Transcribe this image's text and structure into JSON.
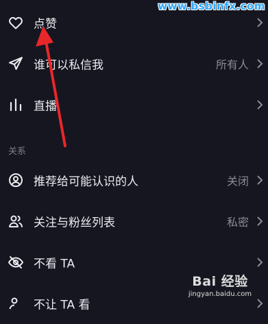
{
  "settings": {
    "items": [
      {
        "label": "点赞",
        "value": ""
      },
      {
        "label": "谁可以私信我",
        "value": "所有人"
      },
      {
        "label": "直播",
        "value": ""
      },
      {
        "label": "推荐给可能认识的人",
        "value": "关闭"
      },
      {
        "label": "关注与粉丝列表",
        "value": "私密"
      },
      {
        "label": "不看 TA",
        "value": ""
      },
      {
        "label": "不让 TA 看",
        "value": ""
      }
    ],
    "section_relations": "关系"
  },
  "watermark": {
    "top": "www.bsbinfx.com",
    "bottom_main": "Bai 经验",
    "bottom_sub": "jingyan.baidu.com"
  },
  "colors": {
    "background": "#15161f",
    "text": "#ececf1",
    "secondary_text": "#8a8b93",
    "annotation_arrow": "#e8272b"
  },
  "icons": [
    "heart-icon",
    "send-icon",
    "live-bars-icon",
    "person-circle-icon",
    "people-icon",
    "eye-slash-icon"
  ]
}
